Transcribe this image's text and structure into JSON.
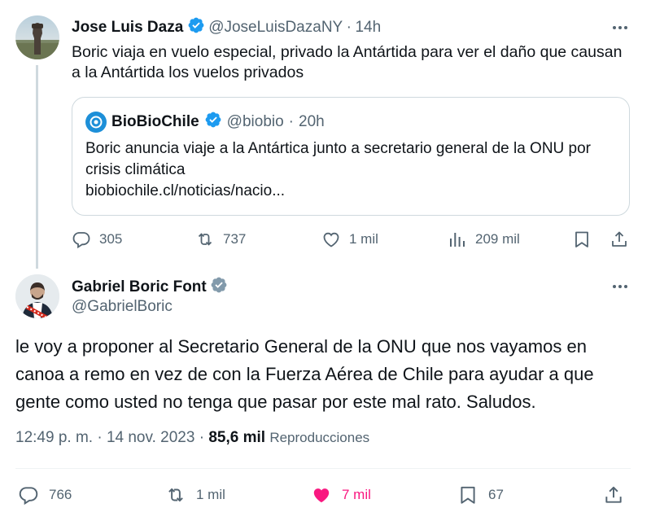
{
  "tweet1": {
    "author": {
      "name": "Jose Luis Daza",
      "handle": "@JoseLuisDazaNY",
      "time": "14h"
    },
    "sep": "·",
    "text": "Boric viaja en vuelo especial, privado la Antártida para ver el daño que causan a la Antártida los vuelos privados",
    "quote": {
      "name": "BioBioChile",
      "handle": "@biobio",
      "time": "20h",
      "text": "Boric anuncia viaje a la Antártica junto a secretario general de la ONU por crisis climática",
      "link": "biobiochile.cl/noticias/nacio..."
    },
    "actions": {
      "replies": "305",
      "reposts": "737",
      "likes": "1 mil",
      "views": "209 mil"
    }
  },
  "tweet2": {
    "author": {
      "name": "Gabriel Boric Font",
      "handle": "@GabrielBoric"
    },
    "text": "le voy a proponer al Secretario General de la ONU que nos vayamos en canoa a remo en vez de con la Fuerza Aérea de Chile para ayudar a que gente como usted no tenga que pasar por este mal rato. Saludos.",
    "meta": {
      "time": "12:49 p. m.",
      "date": "14 nov. 2023",
      "views_count": "85,6 mil",
      "views_label": "Reproducciones"
    },
    "actions": {
      "replies": "766",
      "reposts": "1 mil",
      "likes": "7 mil",
      "bookmarks": "67"
    }
  },
  "colors": {
    "verified": "#1d9bf0",
    "gray_verified": "#829aab",
    "like": "#f91880",
    "muted": "#536471"
  },
  "icons": [
    "verified-badge-icon",
    "more-icon",
    "reply-icon",
    "repost-icon",
    "like-icon",
    "views-icon",
    "bookmark-icon",
    "share-icon"
  ]
}
